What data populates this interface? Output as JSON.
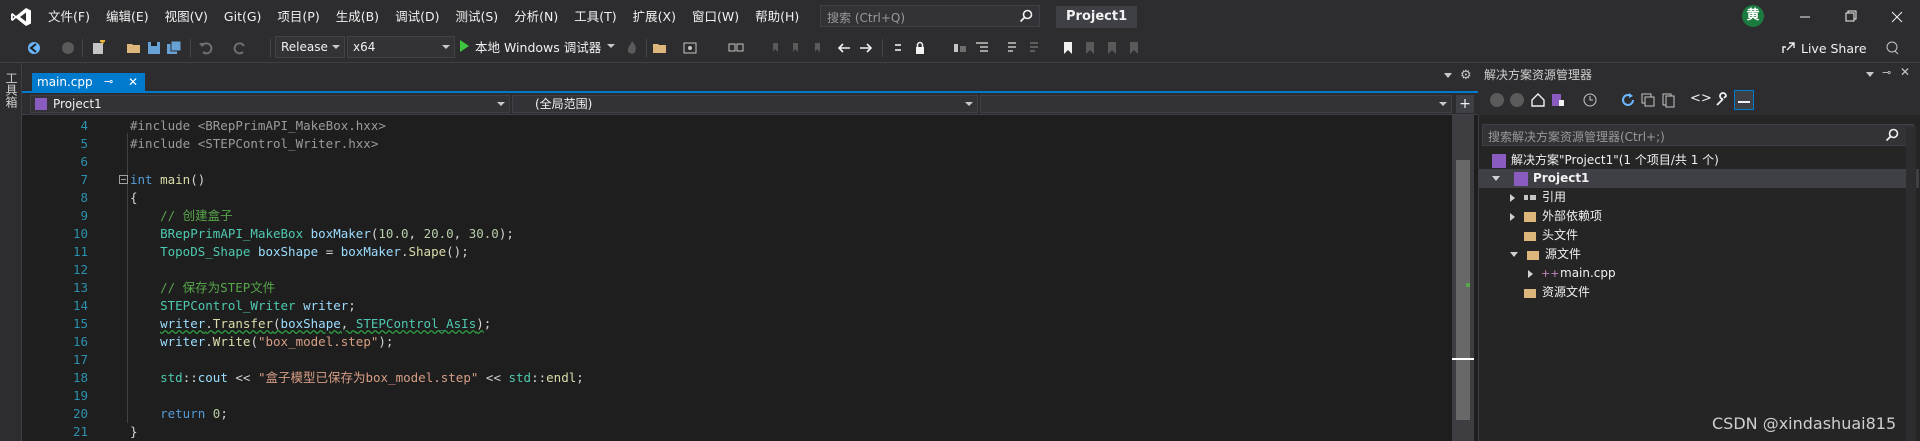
{
  "menu": [
    "文件(F)",
    "编辑(E)",
    "视图(V)",
    "Git(G)",
    "项目(P)",
    "生成(B)",
    "调试(D)",
    "测试(S)",
    "分析(N)",
    "工具(T)",
    "扩展(X)",
    "窗口(W)",
    "帮助(H)"
  ],
  "search": {
    "placeholder": "搜索 (Ctrl+Q)"
  },
  "window_title": "Project1",
  "user_initial": "黄",
  "toolbar": {
    "config": "Release",
    "platform": "x64",
    "run_label": "本地 Windows 调试器",
    "liveshare": "Live Share"
  },
  "toolbox_label": "工具箱",
  "editor": {
    "tab": "main.cpp",
    "nav_project": "Project1",
    "nav_scope": "(全局范围)",
    "lines": [
      {
        "n": "4",
        "html": "<span class='mac'>#include &lt;BRepPrimAPI_MakeBox.hxx&gt;</span>"
      },
      {
        "n": "5",
        "html": "<span class='mac'>#include &lt;STEPControl_Writer.hxx&gt;</span>"
      },
      {
        "n": "6",
        "html": ""
      },
      {
        "n": "7",
        "html": "<span class='kw'>int</span> <span class='fn'>main</span>()"
      },
      {
        "n": "8",
        "html": "{"
      },
      {
        "n": "9",
        "html": "    <span class='cm'>// 创建盒子</span>"
      },
      {
        "n": "10",
        "html": "    <span class='ty'>BRepPrimAPI_MakeBox</span> <span class='var'>boxMaker</span>(<span class='num'>10.0</span>, <span class='num'>20.0</span>, <span class='num'>30.0</span>);"
      },
      {
        "n": "11",
        "html": "    <span class='ty'>TopoDS_Shape</span> <span class='var'>boxShape</span> = <span class='var'>boxMaker</span>.<span class='fn'>Shape</span>();"
      },
      {
        "n": "12",
        "html": ""
      },
      {
        "n": "13",
        "html": "    <span class='cm'>// 保存为STEP文件</span>"
      },
      {
        "n": "14",
        "html": "    <span class='ty'>STEPControl_Writer</span> <span class='var'>writer</span>;"
      },
      {
        "n": "15",
        "html": "    <span class='squig'><span class='var'>writer</span>.<span class='fn'>Transfer</span>(<span class='var'>boxShape</span>, <span class='ty'>STEPControl_AsIs</span>)</span>;"
      },
      {
        "n": "16",
        "html": "    <span class='var'>writer</span>.<span class='fn'>Write</span>(<span class='st'>\"box_model.step\"</span>);"
      },
      {
        "n": "17",
        "html": ""
      },
      {
        "n": "18",
        "html": "    <span class='ty'>std</span>::<span class='var'>cout</span> &lt;&lt; <span class='st'>\"盒子模型已保存为box_model.step\"</span> &lt;&lt; <span class='ty'>std</span>::<span class='fn'>endl</span>;"
      },
      {
        "n": "19",
        "html": ""
      },
      {
        "n": "20",
        "html": "    <span class='kw'>return</span> <span class='num'>0</span>;"
      },
      {
        "n": "21",
        "html": "}"
      }
    ]
  },
  "solution_explorer": {
    "title": "解决方案资源管理器",
    "search_placeholder": "搜索解决方案资源管理器(Ctrl+;)",
    "solution": "解决方案\"Project1\"(1 个项目/共 1 个)",
    "project": "Project1",
    "items": [
      "引用",
      "外部依赖项",
      "头文件",
      "源文件",
      "main.cpp",
      "资源文件"
    ]
  },
  "watermark": "CSDN @xindashuai815",
  "colors": {
    "accent": "#007acc",
    "background": "#1e1e1e",
    "chrome": "#2d2d30"
  }
}
